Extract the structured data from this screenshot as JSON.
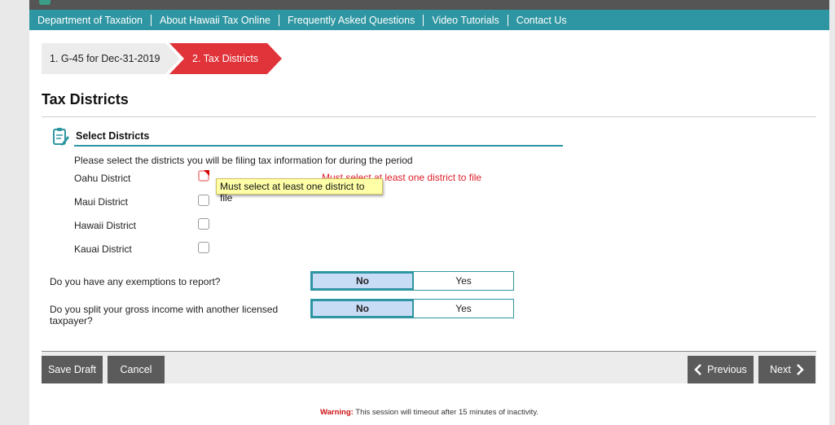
{
  "nav": {
    "items": [
      "Department of Taxation",
      "About Hawaii Tax Online",
      "Frequently Asked Questions",
      "Video Tutorials",
      "Contact Us"
    ]
  },
  "steps": [
    {
      "label": "1. G-45 for Dec-31-2019",
      "active": false
    },
    {
      "label": "2. Tax Districts",
      "active": true
    }
  ],
  "page": {
    "title": "Tax Districts"
  },
  "section": {
    "title": "Select Districts",
    "instructions": "Please select the districts you will be filing tax information for during the period",
    "districts": [
      {
        "label": "Oahu District",
        "checked": false,
        "error": true
      },
      {
        "label": "Maui District",
        "checked": false
      },
      {
        "label": "Hawaii District",
        "checked": false
      },
      {
        "label": "Kauai District",
        "checked": false
      }
    ],
    "error_message": "Must select at least one district to file",
    "tooltip": "Must select at least one district to file"
  },
  "questions": [
    {
      "label": "Do you have any exemptions to report?",
      "options": [
        "No",
        "Yes"
      ],
      "selected": "No"
    },
    {
      "label": "Do you split your gross income with another licensed taxpayer?",
      "options": [
        "No",
        "Yes"
      ],
      "selected": "No"
    }
  ],
  "footer": {
    "save_draft": "Save Draft",
    "cancel": "Cancel",
    "previous": "Previous",
    "next": "Next"
  },
  "warning": {
    "label": "Warning:",
    "text": "This session will timeout after 15 minutes of inactivity."
  },
  "colors": {
    "nav": "#2e96a2",
    "active_step": "#e0333a",
    "error": "#e0202a",
    "button": "#5b5b5b",
    "selected_option": "#c9dcf6"
  }
}
